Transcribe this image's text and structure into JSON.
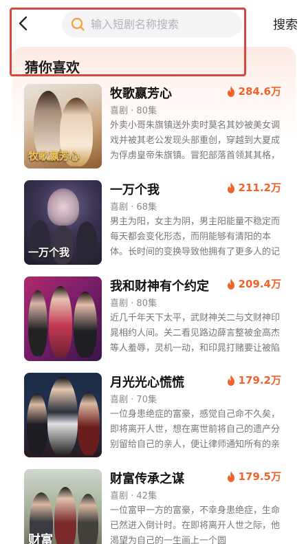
{
  "search": {
    "placeholder": "输入短剧名称搜索",
    "submit_label": "搜索"
  },
  "section": {
    "title": "猜你喜欢"
  },
  "colors": {
    "accent": "#f0632b",
    "highlight": "#d9463e"
  },
  "dramas": [
    {
      "title": "牧歌嬴芳心",
      "heat": "284.6万",
      "genre": "喜剧",
      "episodes": "80集",
      "description": "外卖小哥朱旗镇送外卖时莫名其妙被美女调戏并被其老公发现头部重创，穿越到大夏成为俘虏皇帝朱旗镇。冒犯部落首领其其格，其其格要杀了他，他为…",
      "poster_caption": "牧歌嬴芳心"
    },
    {
      "title": "一万个我",
      "heat": "211.2万",
      "genre": "喜剧",
      "episodes": "68集",
      "description": "男主为阳，女主为阴，男主阳能量不稳定而每天都会变化形态，而阴能够有清阳的本体。长时间的变换导致他拥有了更多人的记忆，墨出尘变得疲惫不堪…",
      "poster_caption": "一万个我"
    },
    {
      "title": "我和财神有个约定",
      "heat": "209.4万",
      "genre": "喜剧",
      "episodes": "80集",
      "description": "近几千年天下太平，武财神关二与文财神印晁相约人间。关二看见路边薛言整被金高杰等人羞辱，灵机一动，和印晁打赌要让被陷害破产后薛言屌丝逆袭…",
      "poster_caption": ""
    },
    {
      "title": "月光光心慌慌",
      "heat": "179.2万",
      "genre": "喜剧",
      "episodes": "70集",
      "description": "一位身患绝症的富豪，感觉自己命不久矣，即将离开人世，想在离世前将自己的遗产分别留给自己的亲人，便让律师通知所有的亲人到场，等待他离开前…",
      "poster_caption": ""
    },
    {
      "title": "财富传承之谋",
      "heat": "179.5万",
      "genre": "喜剧",
      "episodes": "42集",
      "description": "一位富甲一方的富豪，不幸身患绝症，生命已然进入倒计时。在即将离开人世之际，他渴望为自己的一生画上一个圆",
      "poster_caption": "财富"
    }
  ]
}
